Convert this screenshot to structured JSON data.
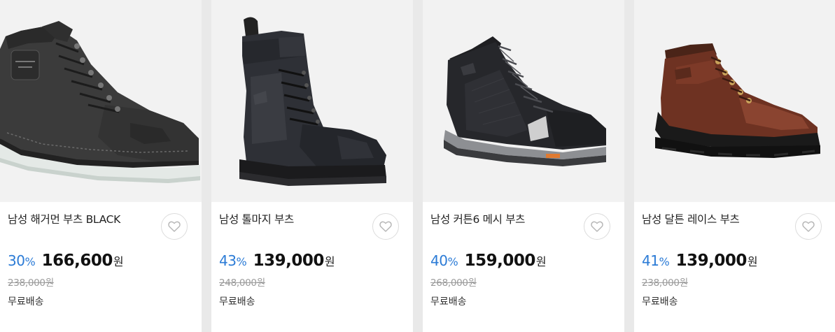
{
  "products": [
    {
      "name": "남성 해거먼 부츠 BLACK",
      "discount_rate": "30",
      "discount_unit": "%",
      "sale_price": "166,600",
      "currency": "원",
      "original_price": "238,000원",
      "shipping": "무료배송",
      "image_icon": "boot-image"
    },
    {
      "name": "남성 톨마지 부츠",
      "discount_rate": "43",
      "discount_unit": "%",
      "sale_price": "139,000",
      "currency": "원",
      "original_price": "248,000원",
      "shipping": "무료배송",
      "image_icon": "boot-image"
    },
    {
      "name": "남성 커튼6 메시 부츠",
      "discount_rate": "40",
      "discount_unit": "%",
      "sale_price": "159,000",
      "currency": "원",
      "original_price": "268,000원",
      "shipping": "무료배송",
      "image_icon": "boot-image"
    },
    {
      "name": "남성 달튼 레이스 부츠",
      "discount_rate": "41",
      "discount_unit": "%",
      "sale_price": "139,000",
      "currency": "원",
      "original_price": "238,000원",
      "shipping": "무료배송",
      "image_icon": "boot-image"
    }
  ],
  "wishlist_icon": "heart-icon",
  "colors": {
    "discount": "#2b7bd6",
    "price": "#111111",
    "original_price": "#9a9a9a",
    "image_background": "#f2f2f2",
    "separator": "#e9e9e9"
  }
}
